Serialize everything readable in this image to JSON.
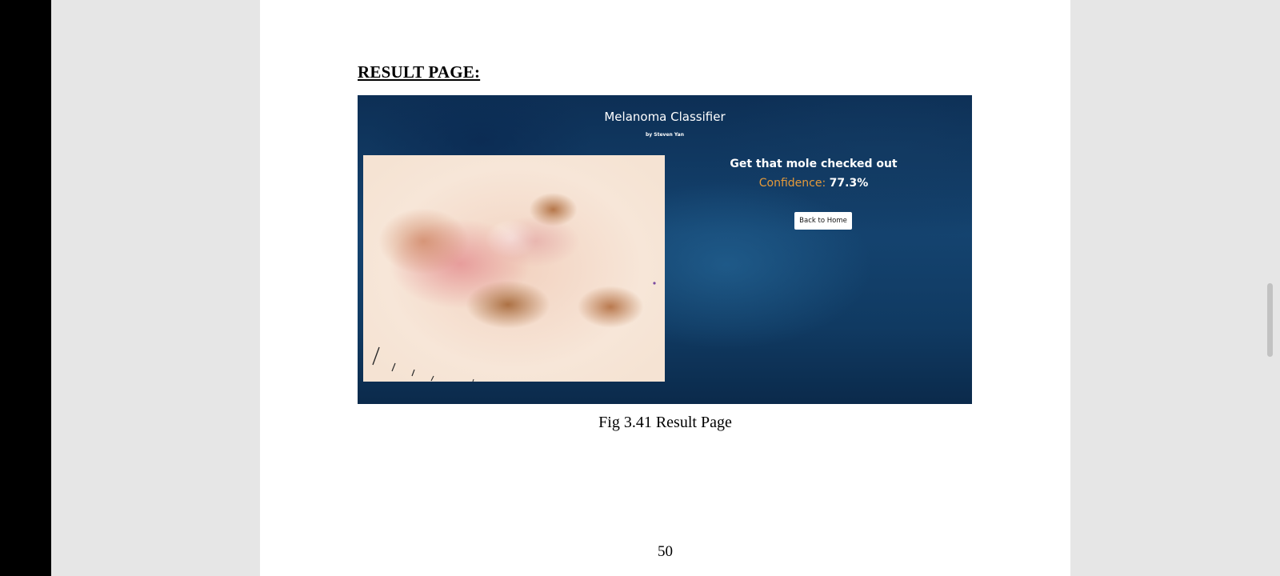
{
  "document": {
    "heading": "RESULT PAGE:",
    "figure_caption": "Fig 3.41 Result Page",
    "page_number": "50"
  },
  "screenshot": {
    "app_title": "Melanoma Classifier",
    "app_subtitle": "by Steven Yan",
    "result_message": "Get that mole checked out",
    "confidence_label": "Confidence:",
    "confidence_value": "77.3%",
    "back_button_label": "Back to Home",
    "image_description": "dermoscopic skin lesion image"
  },
  "colors": {
    "confidence_label": "#e59a3a",
    "screenshot_background": "#14436f",
    "page_background": "#ffffff",
    "viewer_background": "#e6e6e6"
  }
}
